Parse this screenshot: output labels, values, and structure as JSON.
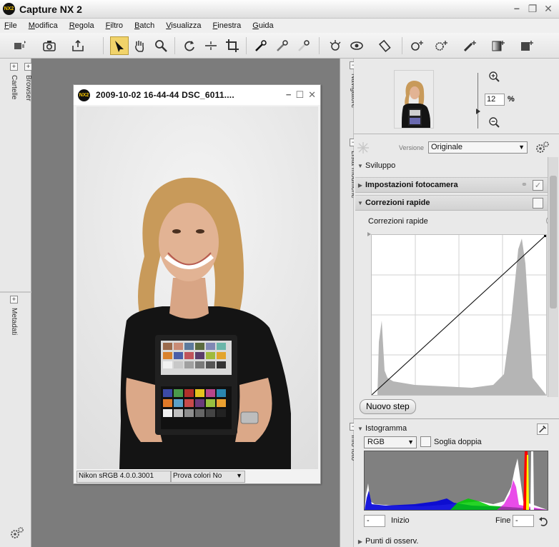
{
  "window": {
    "title": "Capture NX 2",
    "logo_text": "NX2"
  },
  "window_controls": {
    "minimize": "−",
    "restore": "❐",
    "close": "✕"
  },
  "menu": [
    "File",
    "Modifica",
    "Regola",
    "Filtro",
    "Batch",
    "Visualizza",
    "Finestra",
    "Guida"
  ],
  "toolbar": {
    "tools": [
      "browse-icon",
      "camera-icon",
      "output-icon",
      "direct-select-icon",
      "hand-icon",
      "zoom-icon",
      "rotate-icon",
      "straighten-icon",
      "crop-icon",
      "black-point-icon",
      "neutral-point-icon",
      "white-point-icon",
      "red-eye-icon",
      "auto-retouch-icon",
      "lasso-icon",
      "control-point-icon",
      "color-control-point-icon",
      "selection-brush-icon",
      "gradient-icon",
      "fill-icon"
    ],
    "active_tool": "direct-select-icon"
  },
  "left_panel": {
    "tabs": [
      {
        "label": "Cartelle"
      },
      {
        "label": "Browser"
      },
      {
        "label": "Metadati"
      }
    ]
  },
  "document": {
    "logo_text": "NX2",
    "title": "2009-10-02  16-44-44  DSC_6011....",
    "status_profile": "Nikon sRGB 4.0.0.3001",
    "status_proof": "Prova colori No",
    "proof_arrow": "▼"
  },
  "right_tabs": [
    {
      "label": "Navigatore"
    },
    {
      "label": "Lista modifiche"
    },
    {
      "label": "Info foto"
    }
  ],
  "navigator": {
    "zoom_value": "12",
    "zoom_unit": "%"
  },
  "edit_list": {
    "version_label": "Versione",
    "version_value": "Originale",
    "section": "Sviluppo",
    "item1": "Impostazioni fotocamera",
    "item2": "Correzioni rapide",
    "sub_item": "Correzioni rapide",
    "new_step": "Nuovo step"
  },
  "histogram": {
    "title": "Istogramma",
    "channel": "RGB",
    "dual_threshold": "Soglia doppia",
    "start_label": "Inizio",
    "end_label": "Fine",
    "start_value": "-",
    "end_value": "-",
    "footer_item": "Punti di osserv."
  },
  "colors": {
    "accent": "#f1d36a",
    "workspace": "#7c7c7c",
    "panel": "#e9e9e9"
  }
}
